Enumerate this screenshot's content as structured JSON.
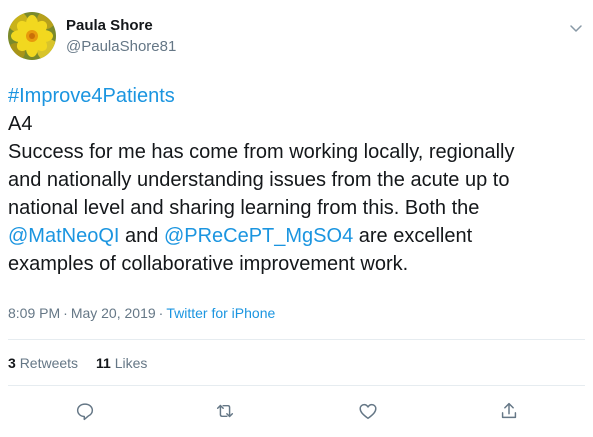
{
  "author": {
    "display_name": "Paula Shore",
    "handle": "@PaulaShore81",
    "avatar_icon": "yellow-flower-avatar"
  },
  "tweet": {
    "hashtag": "#Improve4Patients",
    "line1": "A4",
    "line2": "Success for me has come from working locally, regionally",
    "line3": "and nationally understanding issues from the acute up to",
    "line4": "national level and sharing learning from this. Both the",
    "mention1": "@MatNeoQI",
    "connector": " and ",
    "mention2": "@PReCePT_MgSO4",
    "line5_tail": " are excellent",
    "line6": "examples of collaborative improvement work."
  },
  "meta": {
    "time": "8:09 PM",
    "separator": "·",
    "date": "May 20, 2019",
    "source": "Twitter for iPhone"
  },
  "stats": {
    "retweets_count": "3",
    "retweets_label": "Retweets",
    "likes_count": "11",
    "likes_label": "Likes"
  },
  "colors": {
    "link": "#1b95e0",
    "text": "#14171a",
    "secondary": "#657786",
    "divider": "#e6ecf0"
  },
  "icons": {
    "more": "chevron-down-icon",
    "reply": "reply-icon",
    "retweet": "retweet-icon",
    "like": "heart-icon",
    "share": "share-icon"
  }
}
